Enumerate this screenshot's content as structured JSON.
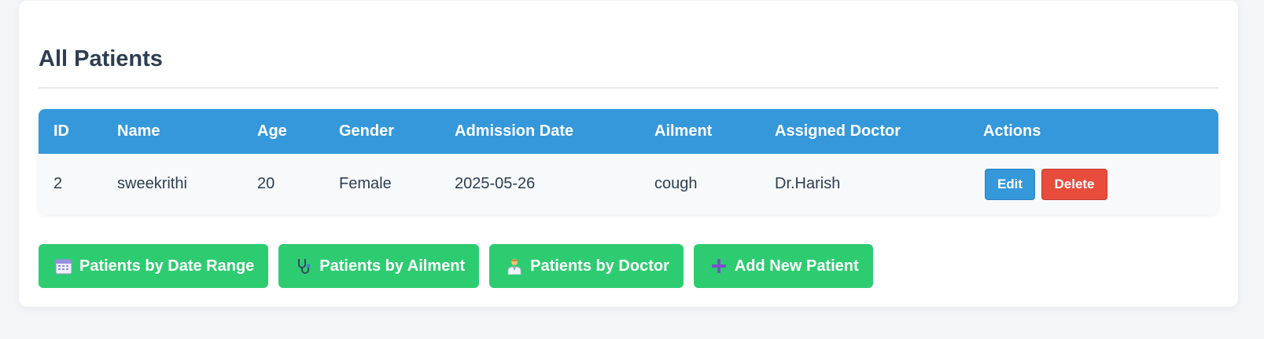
{
  "page": {
    "title": "All Patients"
  },
  "table": {
    "headers": [
      "ID",
      "Name",
      "Age",
      "Gender",
      "Admission Date",
      "Ailment",
      "Assigned Doctor",
      "Actions"
    ],
    "rows": [
      {
        "id": "2",
        "name": "sweekrithi",
        "age": "20",
        "gender": "Female",
        "admission_date": "2025-05-26",
        "ailment": "cough",
        "doctor": "Dr.Harish",
        "edit_label": "Edit",
        "delete_label": "Delete"
      }
    ]
  },
  "actions": [
    {
      "label": "Patients by Date Range",
      "icon": "calendar-icon"
    },
    {
      "label": "Patients by Ailment",
      "icon": "stethoscope-icon"
    },
    {
      "label": "Patients by Doctor",
      "icon": "doctor-icon"
    },
    {
      "label": "Add New Patient",
      "icon": "plus-icon"
    }
  ],
  "colors": {
    "header_blue": "#3498db",
    "action_green": "#2ecc71",
    "delete_red": "#e74c3c",
    "title_text": "#2c3e50"
  }
}
